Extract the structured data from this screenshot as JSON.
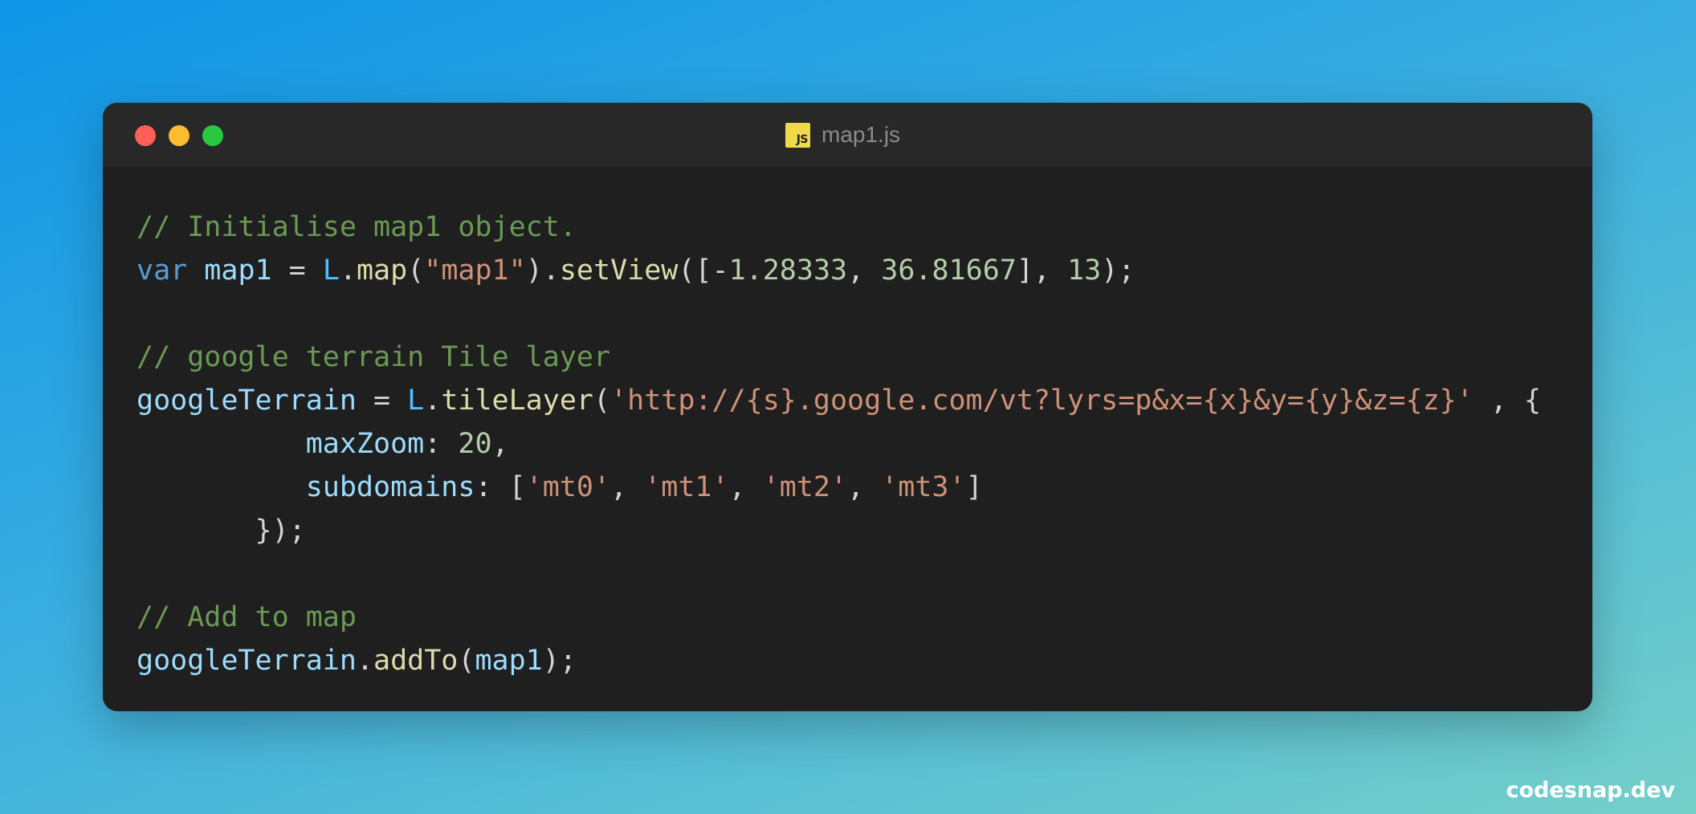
{
  "window": {
    "filename": "map1.js",
    "file_icon_label": "JS",
    "file_icon": "javascript-file-icon",
    "controls": [
      "close",
      "minimize",
      "maximize"
    ]
  },
  "colors": {
    "background_gradient": [
      "#0f94e6",
      "#74cfc9"
    ],
    "window_bg": "#1f1f1f",
    "titlebar_bg": "#282828",
    "comment": "#6a9955",
    "keyword": "#569cd6",
    "variable": "#9cdcfe",
    "function": "#dcdcaa",
    "string": "#ce9178",
    "number": "#b5cea8"
  },
  "code": {
    "lines": [
      [
        {
          "t": "comment",
          "v": "// Initialise map1 object."
        }
      ],
      [
        {
          "t": "keyword",
          "v": "var"
        },
        {
          "t": "punc",
          "v": " "
        },
        {
          "t": "var",
          "v": "map1"
        },
        {
          "t": "punc",
          "v": " = "
        },
        {
          "t": "cls",
          "v": "L"
        },
        {
          "t": "punc",
          "v": "."
        },
        {
          "t": "fn",
          "v": "map"
        },
        {
          "t": "punc",
          "v": "("
        },
        {
          "t": "str",
          "v": "\"map1\""
        },
        {
          "t": "punc",
          "v": ")."
        },
        {
          "t": "fn",
          "v": "setView"
        },
        {
          "t": "punc",
          "v": "([-"
        },
        {
          "t": "num",
          "v": "1.28333"
        },
        {
          "t": "punc",
          "v": ", "
        },
        {
          "t": "num",
          "v": "36.81667"
        },
        {
          "t": "punc",
          "v": "], "
        },
        {
          "t": "num",
          "v": "13"
        },
        {
          "t": "punc",
          "v": ");"
        }
      ],
      [],
      [
        {
          "t": "comment",
          "v": "// google terrain Tile layer"
        }
      ],
      [
        {
          "t": "var",
          "v": "googleTerrain"
        },
        {
          "t": "punc",
          "v": " = "
        },
        {
          "t": "cls",
          "v": "L"
        },
        {
          "t": "punc",
          "v": "."
        },
        {
          "t": "fn",
          "v": "tileLayer"
        },
        {
          "t": "punc",
          "v": "("
        },
        {
          "t": "str",
          "v": "'http://{s}.google.com/vt?lyrs=p&x={x}&y={y}&z={z}'"
        },
        {
          "t": "punc",
          "v": " , {"
        }
      ],
      [
        {
          "t": "punc",
          "v": "          "
        },
        {
          "t": "var",
          "v": "maxZoom"
        },
        {
          "t": "punc",
          "v": ": "
        },
        {
          "t": "num",
          "v": "20"
        },
        {
          "t": "punc",
          "v": ","
        }
      ],
      [
        {
          "t": "punc",
          "v": "          "
        },
        {
          "t": "var",
          "v": "subdomains"
        },
        {
          "t": "punc",
          "v": ": ["
        },
        {
          "t": "str",
          "v": "'mt0'"
        },
        {
          "t": "punc",
          "v": ", "
        },
        {
          "t": "str",
          "v": "'mt1'"
        },
        {
          "t": "punc",
          "v": ", "
        },
        {
          "t": "str",
          "v": "'mt2'"
        },
        {
          "t": "punc",
          "v": ", "
        },
        {
          "t": "str",
          "v": "'mt3'"
        },
        {
          "t": "punc",
          "v": "]"
        }
      ],
      [
        {
          "t": "punc",
          "v": "       });"
        }
      ],
      [],
      [
        {
          "t": "comment",
          "v": "// Add to map"
        }
      ],
      [
        {
          "t": "var",
          "v": "googleTerrain"
        },
        {
          "t": "punc",
          "v": "."
        },
        {
          "t": "fn",
          "v": "addTo"
        },
        {
          "t": "punc",
          "v": "("
        },
        {
          "t": "var",
          "v": "map1"
        },
        {
          "t": "punc",
          "v": ");"
        }
      ]
    ]
  },
  "watermark": "codesnap.dev"
}
